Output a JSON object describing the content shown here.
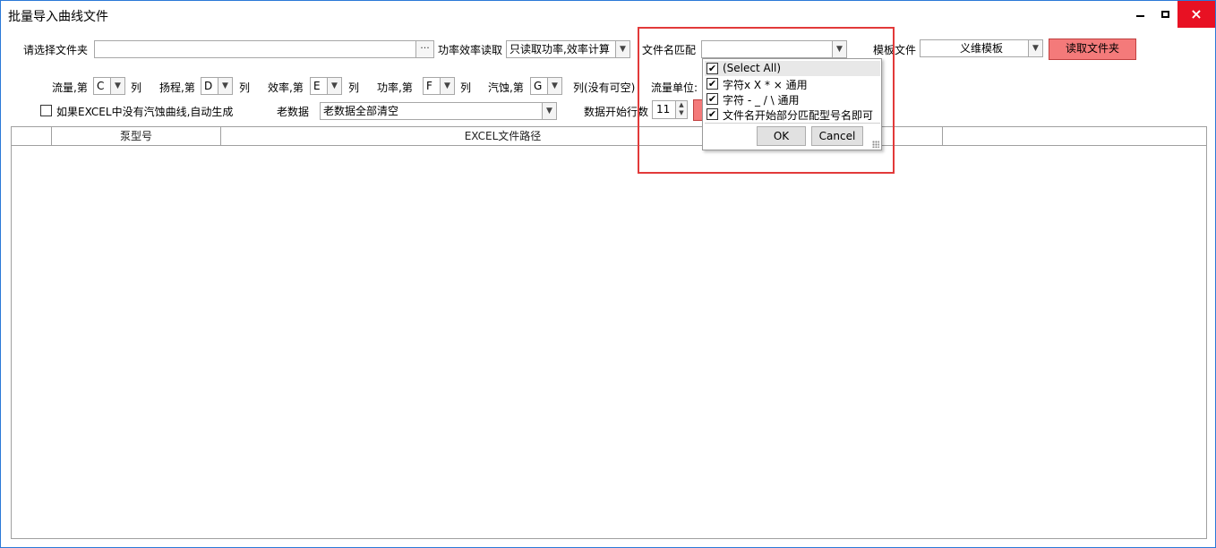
{
  "window": {
    "title": "批量导入曲线文件"
  },
  "row1": {
    "folder_label": "请选择文件夹",
    "folder_value": "",
    "folder_browse": "···",
    "power_label": "功率效率读取",
    "power_value": "只读取功率,效率计算",
    "match_label": "文件名匹配",
    "match_value": "",
    "template_label": "模板文件",
    "template_value": "义维模板",
    "read_button": "读取文件夹"
  },
  "row2": {
    "flow_label": "流量,第",
    "flow_col": "C",
    "head_label": "扬程,第",
    "head_col": "D",
    "eff_label": "效率,第",
    "eff_col": "E",
    "pow_label": "功率,第",
    "pow_col": "F",
    "npsh_label": "汽蚀,第",
    "npsh_col": "G",
    "col_suffix": "列",
    "npsh_suffix": "列(没有可空)",
    "flow_unit_label": "流量单位:"
  },
  "row3": {
    "auto_npsh_label": "如果EXCEL中没有汽蚀曲线,自动生成",
    "old_data_label": "老数据",
    "old_data_value": "老数据全部清空",
    "start_row_label": "数据开始行数",
    "start_row_value": "11"
  },
  "grid": {
    "columns": [
      "",
      "泵型号",
      "EXCEL文件路径",
      "",
      ""
    ]
  },
  "popup": {
    "items": [
      {
        "label": "(Select All)",
        "checked": true
      },
      {
        "label": "字符x X * × 通用",
        "checked": true
      },
      {
        "label": "字符 - _ / \\ 通用",
        "checked": true
      },
      {
        "label": "文件名开始部分匹配型号名即可",
        "checked": true
      }
    ],
    "check_glyph": "✔",
    "ok": "OK",
    "cancel": "Cancel"
  },
  "icons": {
    "dropdown": "▼",
    "minimize": "minimize-icon",
    "maximize": "maximize-icon",
    "close": "×"
  },
  "colors": {
    "accent_red": "#f47a7a",
    "highlight": "#e23a3a",
    "close_red": "#e81123"
  }
}
